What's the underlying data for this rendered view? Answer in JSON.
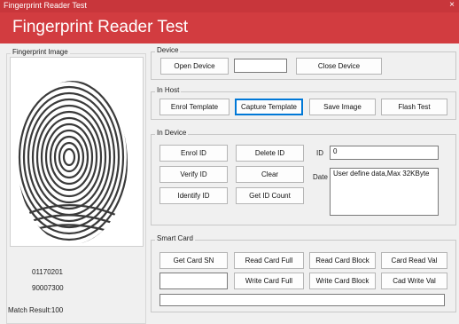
{
  "window": {
    "title": "Fingerprint Reader Test",
    "close_glyph": "×"
  },
  "banner": {
    "title": "Fingerprint Reader Test"
  },
  "image_panel": {
    "label": "Fingerprint Image",
    "info_line1": "01170201",
    "info_line2": "90007300",
    "match_result": "Match Result:100"
  },
  "device": {
    "label": "Device",
    "open_label": "Open Device",
    "status_value": "",
    "close_label": "Close Device"
  },
  "in_host": {
    "label": "In Host",
    "enrol_label": "Enrol Template",
    "capture_label": "Capture Template",
    "save_label": "Save Image",
    "flash_label": "Flash Test"
  },
  "in_device": {
    "label": "In Device",
    "enrol_id": "Enrol ID",
    "delete_id": "Delete ID",
    "verify_id": "Verify ID",
    "clear": "Clear",
    "identify_id": "Identify ID",
    "get_id_count": "Get ID Count",
    "id_label": "ID",
    "id_value": "0",
    "date_label": "Date",
    "date_value": "User define data,Max 32KByte"
  },
  "smart_card": {
    "label": "Smart Card",
    "get_sn": "Get Card SN",
    "read_full": "Read Card Full",
    "read_block": "Read Card Block",
    "read_val": "Card Read Val",
    "write_full": "Write Card Full",
    "write_block": "Write Card Block",
    "write_val": "Cad Write Val",
    "sn_value": "",
    "status_value": ""
  },
  "colors": {
    "banner": "#d23c40",
    "titlebar": "#c8363b",
    "focus": "#0078d7"
  }
}
